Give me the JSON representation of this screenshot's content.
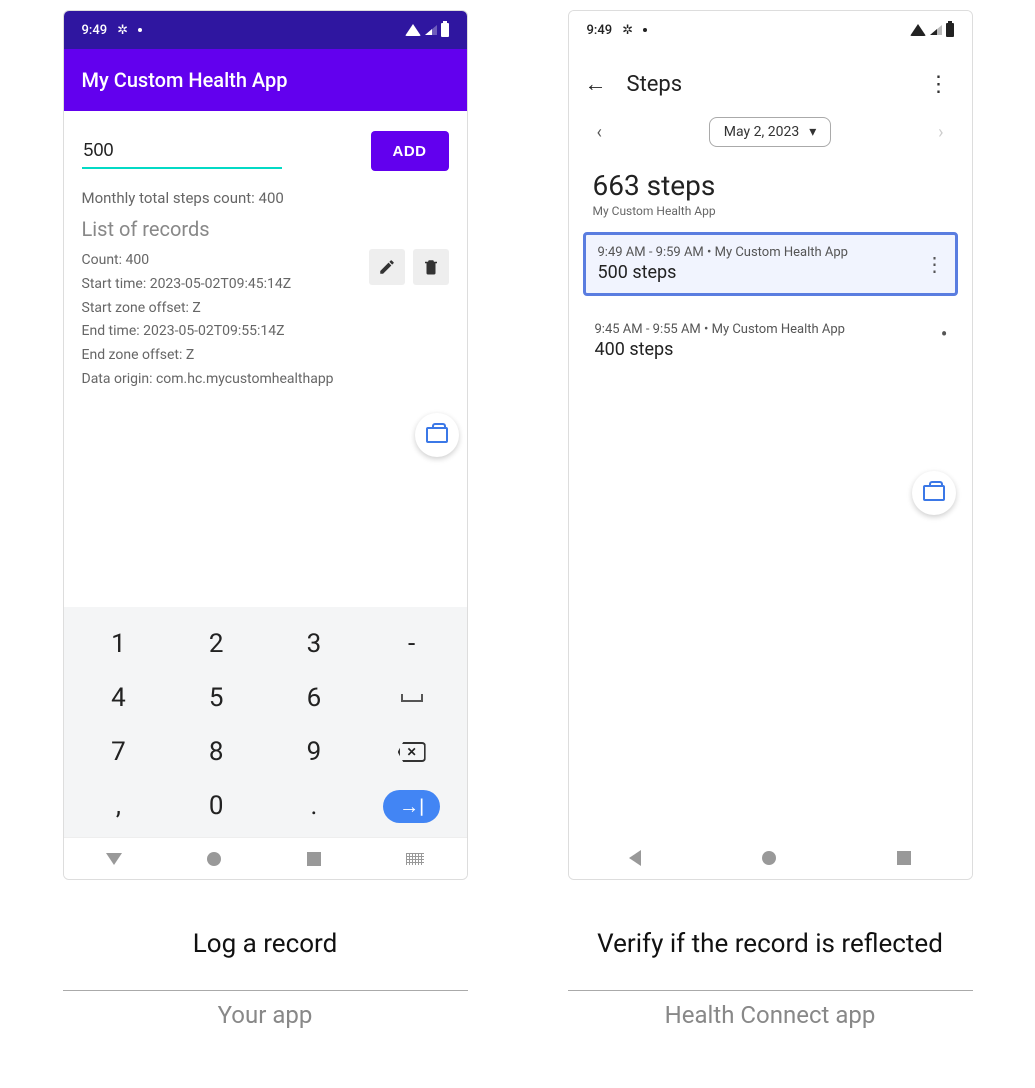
{
  "status": {
    "time": "9:49"
  },
  "left": {
    "app_title": "My Custom Health App",
    "input_value": "500",
    "add_label": "ADD",
    "summary": "Monthly total steps count: 400",
    "list_heading": "List of records",
    "record": {
      "count": "Count: 400",
      "start": "Start time: 2023-05-02T09:45:14Z",
      "start_zone": "Start zone offset: Z",
      "end": "End time: 2023-05-02T09:55:14Z",
      "end_zone": "End zone offset: Z",
      "origin": "Data origin: com.hc.mycustomhealthapp"
    },
    "keys": {
      "r1": [
        "1",
        "2",
        "3",
        "-"
      ],
      "r2": [
        "4",
        "5",
        "6",
        "⎵"
      ],
      "r3": [
        "7",
        "8",
        "9",
        "⌫"
      ],
      "r4": [
        ",",
        "0",
        ".",
        "↵"
      ]
    },
    "caption1": "Log a record",
    "caption2": "Your app"
  },
  "right": {
    "title": "Steps",
    "date": "May 2, 2023",
    "total": "663 steps",
    "source": "My Custom Health App",
    "entries": [
      {
        "meta": "9:49 AM - 9:59 AM • My Custom Health App",
        "val": "500 steps",
        "hl": true
      },
      {
        "meta": "9:45 AM - 9:55 AM • My Custom Health App",
        "val": "400 steps",
        "hl": false
      }
    ],
    "caption1": "Verify if the record is reflected",
    "caption2": "Health Connect app"
  }
}
